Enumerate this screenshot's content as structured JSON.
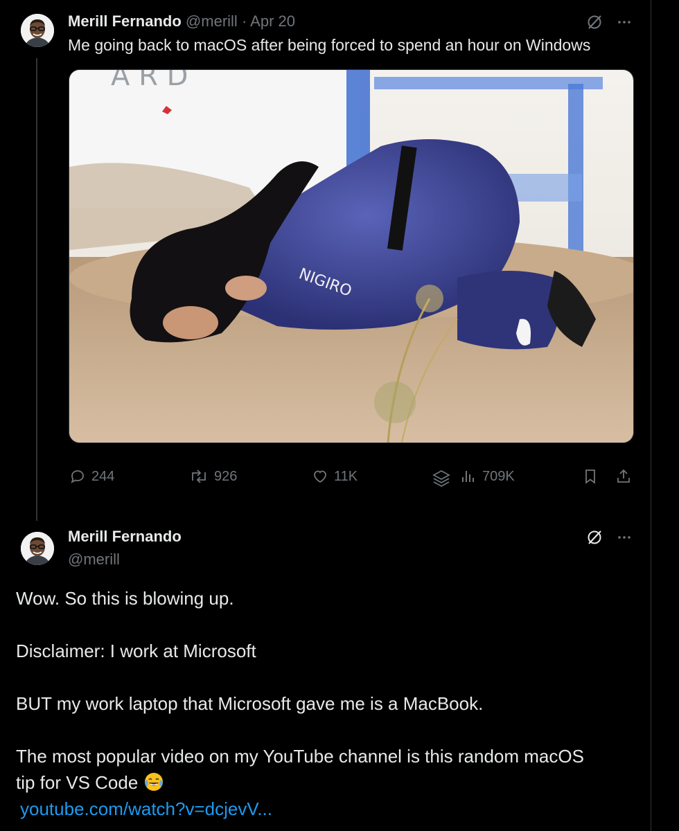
{
  "tweet1": {
    "author_name": "Merill Fernando",
    "author_handle": "@merill",
    "date": "· Apr 20",
    "text": "Me going back to macOS after being forced to spend an hour on Windows",
    "actions": {
      "replies": "244",
      "reposts": "926",
      "likes": "11K",
      "views": "709K"
    },
    "icons": [
      "grok-icon",
      "more-icon",
      "reply-icon",
      "repost-icon",
      "like-icon",
      "layers-icon",
      "views-icon",
      "bookmark-icon",
      "share-icon"
    ]
  },
  "tweet2": {
    "author_name": "Merill Fernando",
    "author_handle": "@merill",
    "paragraphs": [
      "Wow. So this is blowing up.",
      "Disclaimer: I work at Microsoft",
      "BUT my work laptop that Microsoft gave me is a MacBook.",
      "The most popular video on my YouTube channel is this random macOS",
      "tip for VS Code"
    ],
    "link": "youtube.com/watch?v=dcjevV...",
    "emoji": "face-with-tears-of-joy"
  },
  "colors": {
    "background": "#000000",
    "text": "#e7e9ea",
    "secondary": "#71767b",
    "link": "#1d9bf0",
    "border": "#2f3336"
  }
}
